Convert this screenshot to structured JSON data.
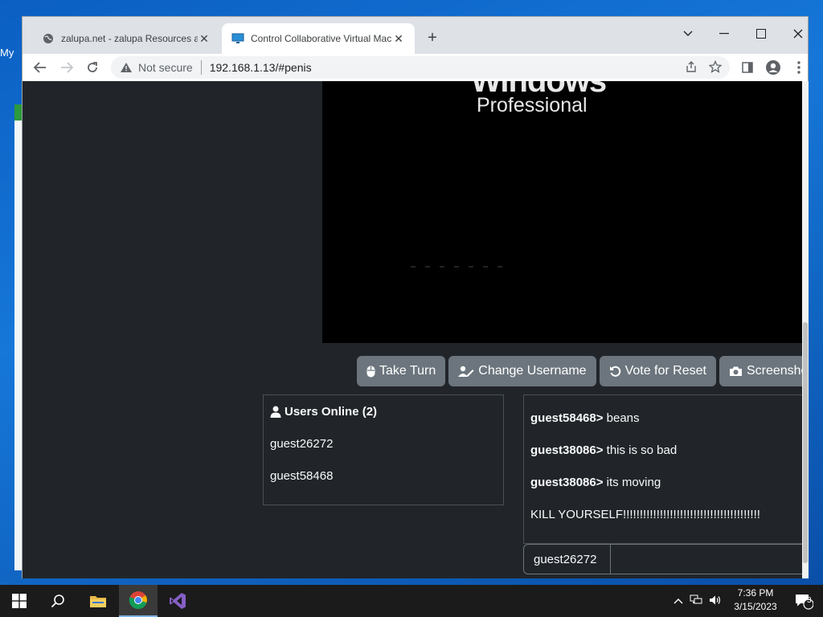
{
  "desktop": {
    "label": "My"
  },
  "browser": {
    "tabs": [
      {
        "title": "zalupa.net - zalupa Resources and",
        "icon": "globe-icon"
      },
      {
        "title": "Control Collaborative Virtual Machine",
        "icon": "monitor-icon"
      }
    ],
    "address": {
      "security_label": "Not secure",
      "url": "192.168.1.13/#penis"
    }
  },
  "vm": {
    "screen_title_top": "Windows",
    "screen_title_bottom": "Professional",
    "buttons": [
      {
        "label": "Take Turn",
        "icon": "mouse-icon"
      },
      {
        "label": "Change Username",
        "icon": "user-edit-icon"
      },
      {
        "label": "Vote for Reset",
        "icon": "undo-icon"
      },
      {
        "label": "Screenshot",
        "icon": "camera-icon"
      }
    ]
  },
  "users": {
    "heading": "Users Online (2)",
    "list": [
      "guest26272",
      "guest58468"
    ]
  },
  "chat": {
    "messages": [
      {
        "user": "guest58468>",
        "text": " beans"
      },
      {
        "user": "guest38086>",
        "text": " this is so bad"
      },
      {
        "user": "guest38086>",
        "text": " its moving"
      },
      {
        "user": "",
        "text": "KILL YOURSELF!!!!!!!!!!!!!!!!!!!!!!!!!!!!!!!!!!!!!!!!!"
      }
    ],
    "username": "guest26272",
    "input_value": ""
  },
  "taskbar": {
    "apps": [
      "windows-start-icon",
      "search-icon",
      "file-explorer-icon",
      "chrome-icon",
      "visual-studio-icon"
    ],
    "clock_time": "7:36 PM",
    "clock_date": "3/15/2023",
    "notification_count": "3"
  }
}
